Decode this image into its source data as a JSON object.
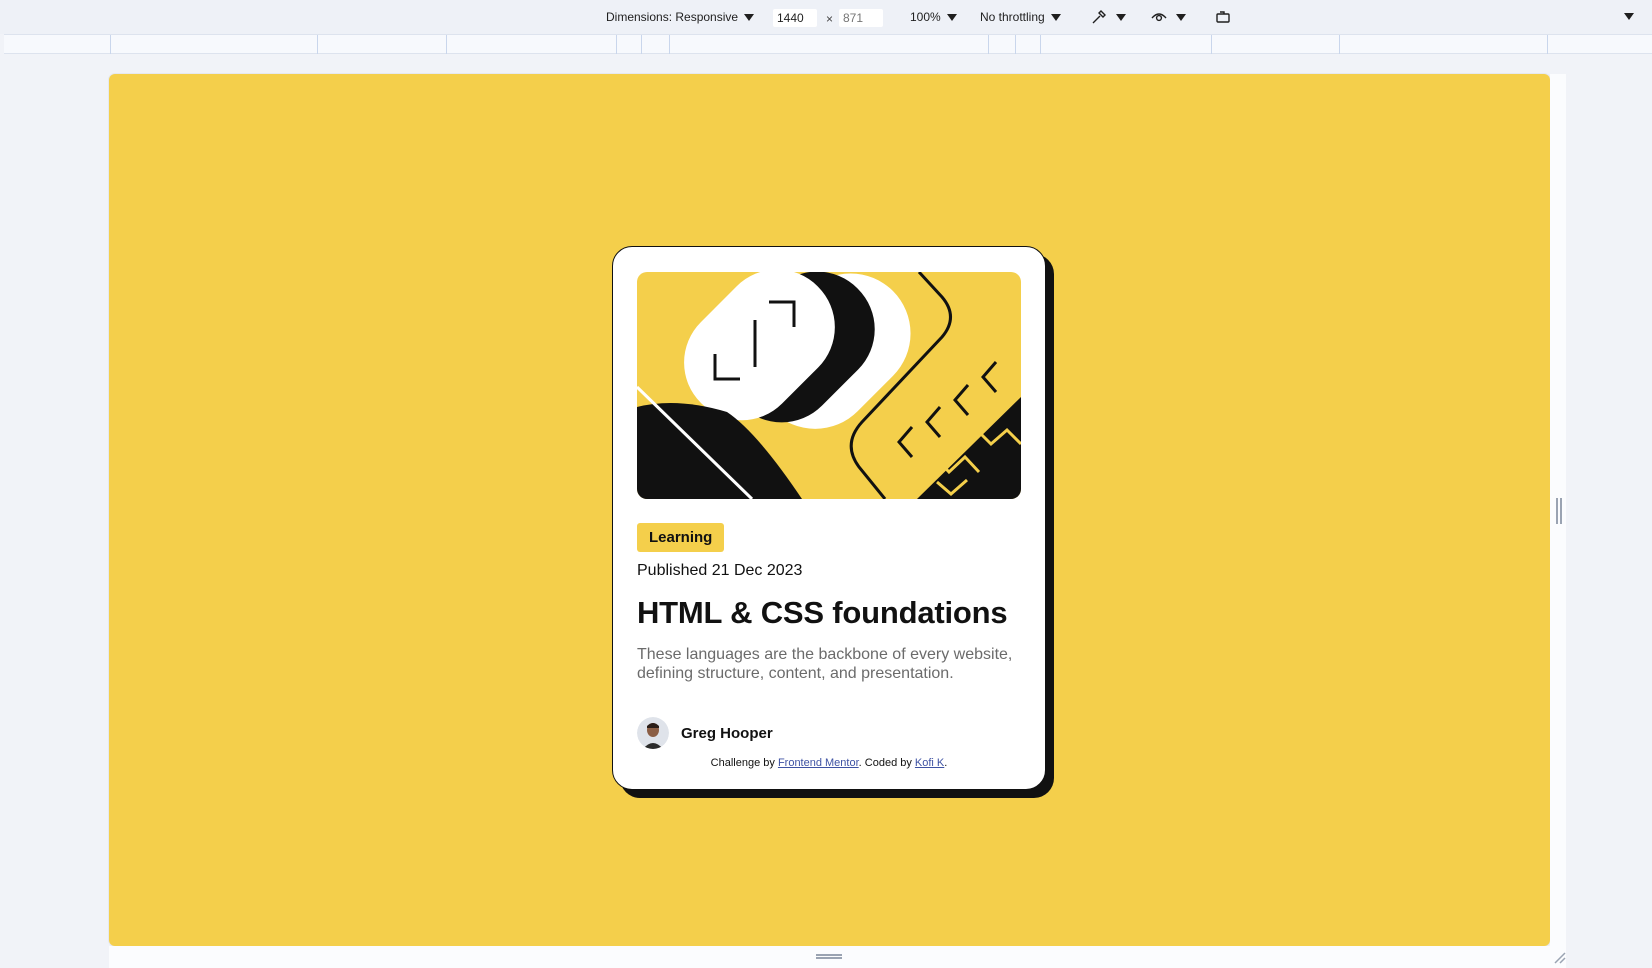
{
  "toolbar": {
    "dimensions_label": "Dimensions: Responsive",
    "width_value": "1440",
    "height_placeholder": "871",
    "times": "×",
    "zoom": "100%",
    "throttling": "No throttling"
  },
  "card": {
    "tag": "Learning",
    "published": "Published 21 Dec 2023",
    "title": "HTML & CSS foundations",
    "description": "These languages are the backbone of every website, defining structure, content, and presentation.",
    "author": "Greg Hooper",
    "attribution": {
      "prefix": "Challenge by ",
      "link1": "Frontend Mentor",
      "middle": ". Coded by ",
      "link2": "Kofi K",
      "suffix": "."
    }
  },
  "colors": {
    "background": "#f4cf4b",
    "card": "#ffffff",
    "ink": "#111111",
    "link": "#3e52a3"
  },
  "icons": [
    "chevron-down-icon",
    "eyedropper-icon",
    "eye-icon",
    "rotate-device-icon",
    "more-options-icon"
  ]
}
